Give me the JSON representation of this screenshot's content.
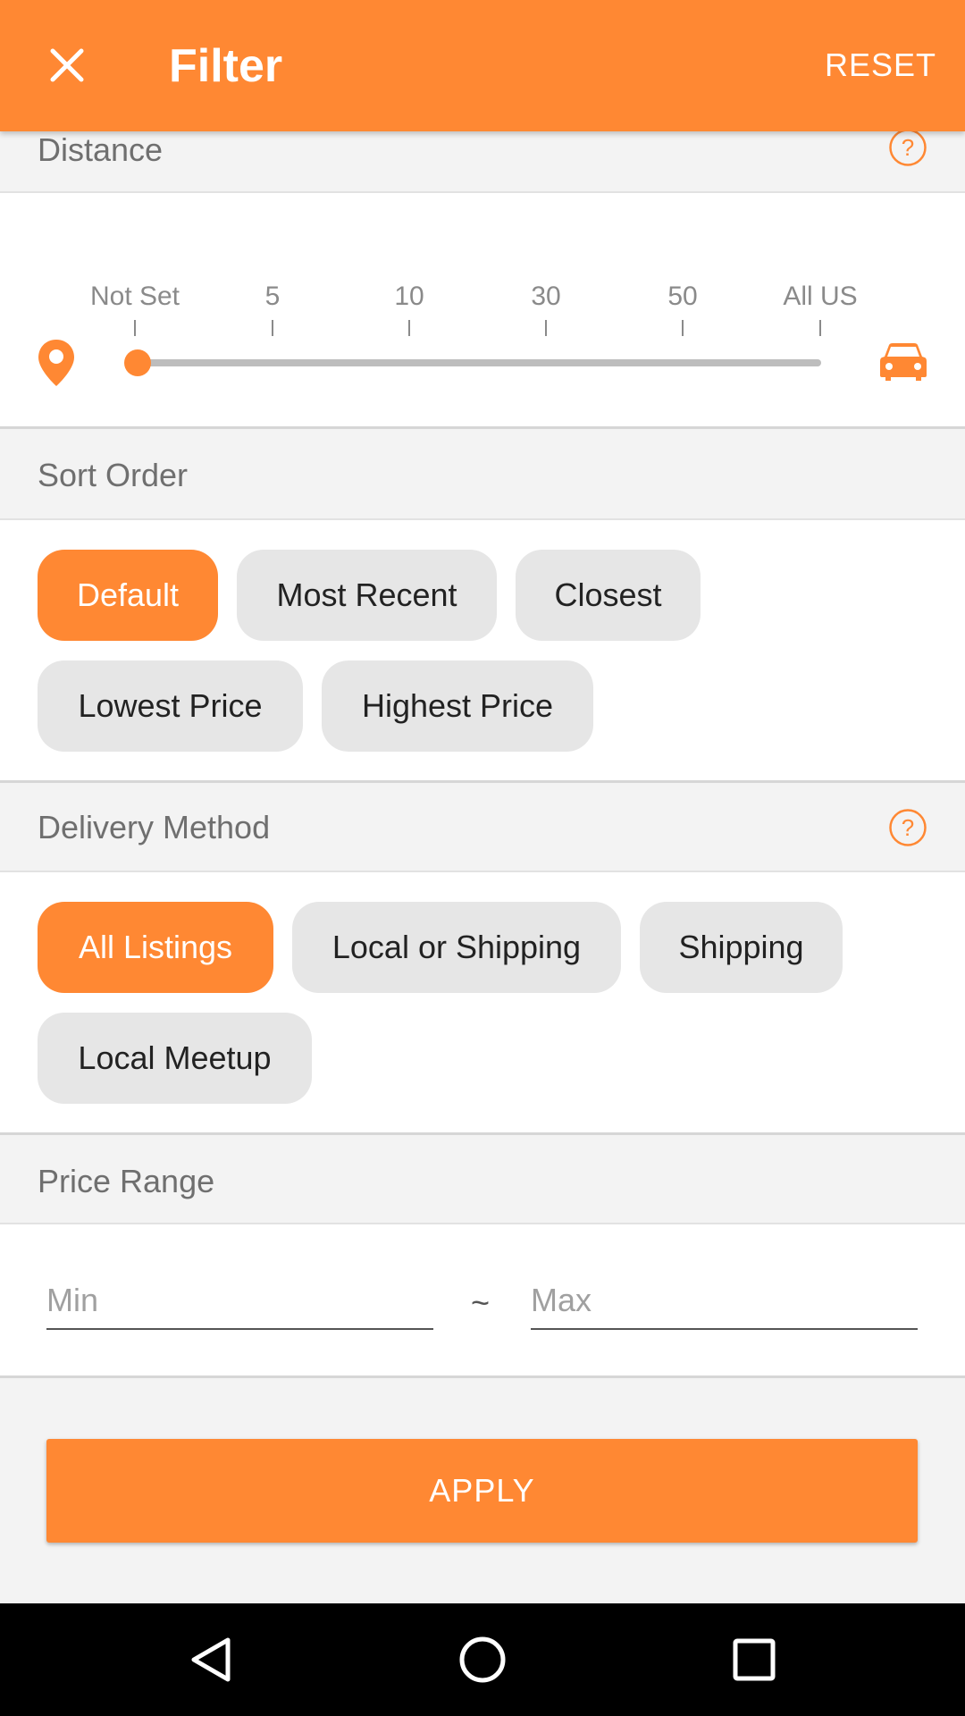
{
  "colors": {
    "accent": "#ff8833",
    "chip_bg": "#e6e6e6",
    "section_bg": "#f3f3f3"
  },
  "appbar": {
    "title": "Filter",
    "reset_label": "RESET",
    "close_icon": "close-icon"
  },
  "distance": {
    "header": "Distance",
    "help_icon": "help-icon",
    "ticks": [
      "Not Set",
      "5",
      "10",
      "30",
      "50",
      "All US"
    ],
    "selected_index": 0,
    "start_icon": "map-pin-icon",
    "end_icon": "car-icon"
  },
  "sort": {
    "header": "Sort Order",
    "options": [
      "Default",
      "Most Recent",
      "Closest",
      "Lowest Price",
      "Highest Price"
    ],
    "selected": "Default"
  },
  "delivery": {
    "header": "Delivery Method",
    "help_icon": "help-icon",
    "options": [
      "All Listings",
      "Local or Shipping",
      "Shipping",
      "Local Meetup"
    ],
    "selected": "All Listings"
  },
  "price": {
    "header": "Price Range",
    "min_placeholder": "Min",
    "max_placeholder": "Max",
    "min_value": "",
    "max_value": "",
    "separator": "~"
  },
  "apply_label": "APPLY",
  "navbar": {
    "back_icon": "back-icon",
    "home_icon": "home-icon",
    "recents_icon": "recents-icon"
  }
}
